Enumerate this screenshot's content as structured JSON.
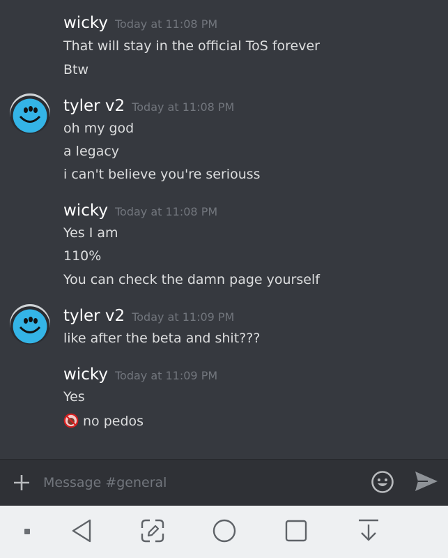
{
  "messages": [
    {
      "author": "wicky",
      "timestamp": "Today at 11:08 PM",
      "lines": [
        "That will stay in the official ToS forever",
        "Btw"
      ]
    },
    {
      "author": "tyler v2",
      "timestamp": "Today at 11:08 PM",
      "lines": [
        "oh my god",
        "a legacy",
        "i can't believe you're seriouss"
      ]
    },
    {
      "author": "wicky",
      "timestamp": "Today at 11:08 PM",
      "lines": [
        "Yes I am",
        "110%",
        "You can check the damn page yourself"
      ]
    },
    {
      "author": "tyler v2",
      "timestamp": "Today at 11:09 PM",
      "lines": [
        "like after the beta and shit???"
      ]
    },
    {
      "author": "wicky",
      "timestamp": "Today at 11:09 PM",
      "lines": [
        "Yes",
        "no pedos"
      ]
    }
  ],
  "composer": {
    "placeholder": "Message #general",
    "icons": {
      "attach": "plus-icon",
      "emoji": "smiley-icon",
      "send": "send-icon"
    }
  },
  "navbar": {
    "icons": [
      "dot-icon",
      "back-triangle-icon",
      "edit-screenshot-icon",
      "home-circle-icon",
      "recents-square-icon",
      "notification-pull-icon"
    ]
  },
  "colors": {
    "background": "#36393f",
    "composer": "#2f3136",
    "author": "#ffffff",
    "timestamp": "#72767d",
    "text": "#dcddde",
    "navbar": "#eef0f2"
  }
}
